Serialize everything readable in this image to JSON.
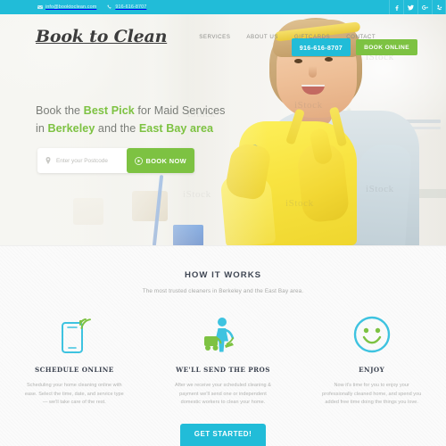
{
  "topbar": {
    "email": "info@booktoclean.com",
    "phone": "916-616-8707",
    "email_icon": "envelope-icon",
    "phone_icon": "phone-icon",
    "social": [
      {
        "name": "facebook",
        "glyph": "f"
      },
      {
        "name": "twitter",
        "glyph": "t"
      },
      {
        "name": "google-plus",
        "glyph": "g+"
      },
      {
        "name": "yelp",
        "glyph": "y"
      }
    ]
  },
  "header": {
    "logo": "Book to Clean",
    "nav": [
      {
        "label": "SERVICES"
      },
      {
        "label": "ABOUT US"
      },
      {
        "label": "GIFTCARDS"
      },
      {
        "label": "CONTACT"
      }
    ],
    "phone_button": "916-616-8707",
    "book_online_button": "BOOK ONLINE"
  },
  "hero": {
    "headline_part1": "Book the ",
    "headline_em1": "Best Pick",
    "headline_part2": " for Maid Services",
    "headline_part3": "in ",
    "headline_em2": "Berkeley",
    "headline_part4": " and the ",
    "headline_em3": "East Bay area",
    "postcode_placeholder": "Enter your Postcode",
    "postcode_value": "",
    "book_now_button": "BOOK NOW",
    "pin_icon": "map-pin-icon",
    "play_icon": "play-circle-icon",
    "watermark": "iStock"
  },
  "works": {
    "title": "HOW IT WORKS",
    "subtitle": "The most trusted cleaners in Berkeley and the East Bay area.",
    "columns": [
      {
        "icon": "mobile-phone-wifi-icon",
        "heading": "SCHEDULE ONLINE",
        "body": "Scheduling your home cleaning online with ease. Select the time, date, and service type — we'll take care of the rest."
      },
      {
        "icon": "vacuum-cleaner-person-icon",
        "heading": "WE'LL SEND THE PROS",
        "body": "After we receive your scheduled cleaning & payment we'll send one or independent domestic workers to clean your home."
      },
      {
        "icon": "smiley-face-icon",
        "heading": "ENJOY",
        "body": "Now it's time for you to enjoy your professionally cleaned home, and spend you added free time doing the things you love."
      }
    ],
    "get_started_button": "GET STARTED!"
  },
  "colors": {
    "cyan": "#21bcd8",
    "green": "#7dc242",
    "dark_text": "#3f4653",
    "muted_text": "#b2b3b1",
    "hero_bg": "#f2f1ec"
  }
}
